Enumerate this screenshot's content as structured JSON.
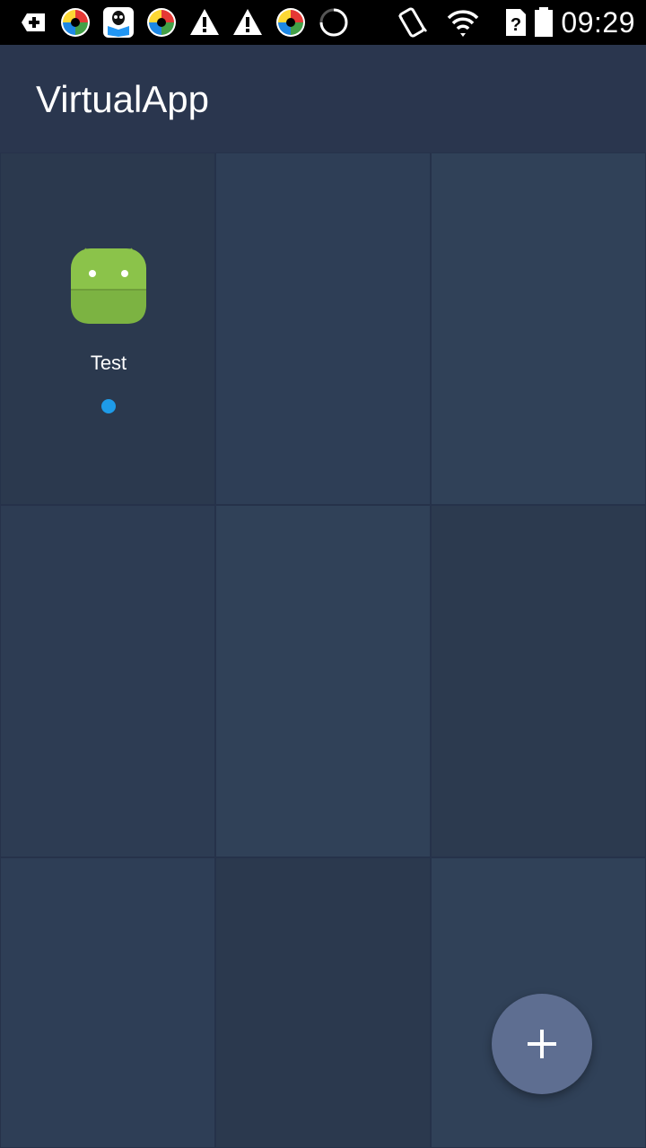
{
  "status_bar": {
    "time": "09:29",
    "notification_icons": [
      "add-box-icon",
      "circular-app-icon",
      "qq-reader-icon",
      "circular-app-icon",
      "warning-icon",
      "warning-icon",
      "circular-app-icon",
      "loading-spinner-icon"
    ],
    "system_icons": [
      "vibrate-icon",
      "wifi-icon",
      "sim-unknown-icon",
      "battery-icon"
    ]
  },
  "app_bar": {
    "title": "VirtualApp"
  },
  "grid": {
    "apps": [
      {
        "label": "Test",
        "icon": "android-icon",
        "indicator_color": "#1e9be8"
      }
    ]
  },
  "fab": {
    "icon": "plus-icon"
  },
  "colors": {
    "background": "#2c3a4f",
    "app_bar": "#2a364e",
    "fab": "#5e6e91",
    "indicator": "#1e9be8"
  }
}
